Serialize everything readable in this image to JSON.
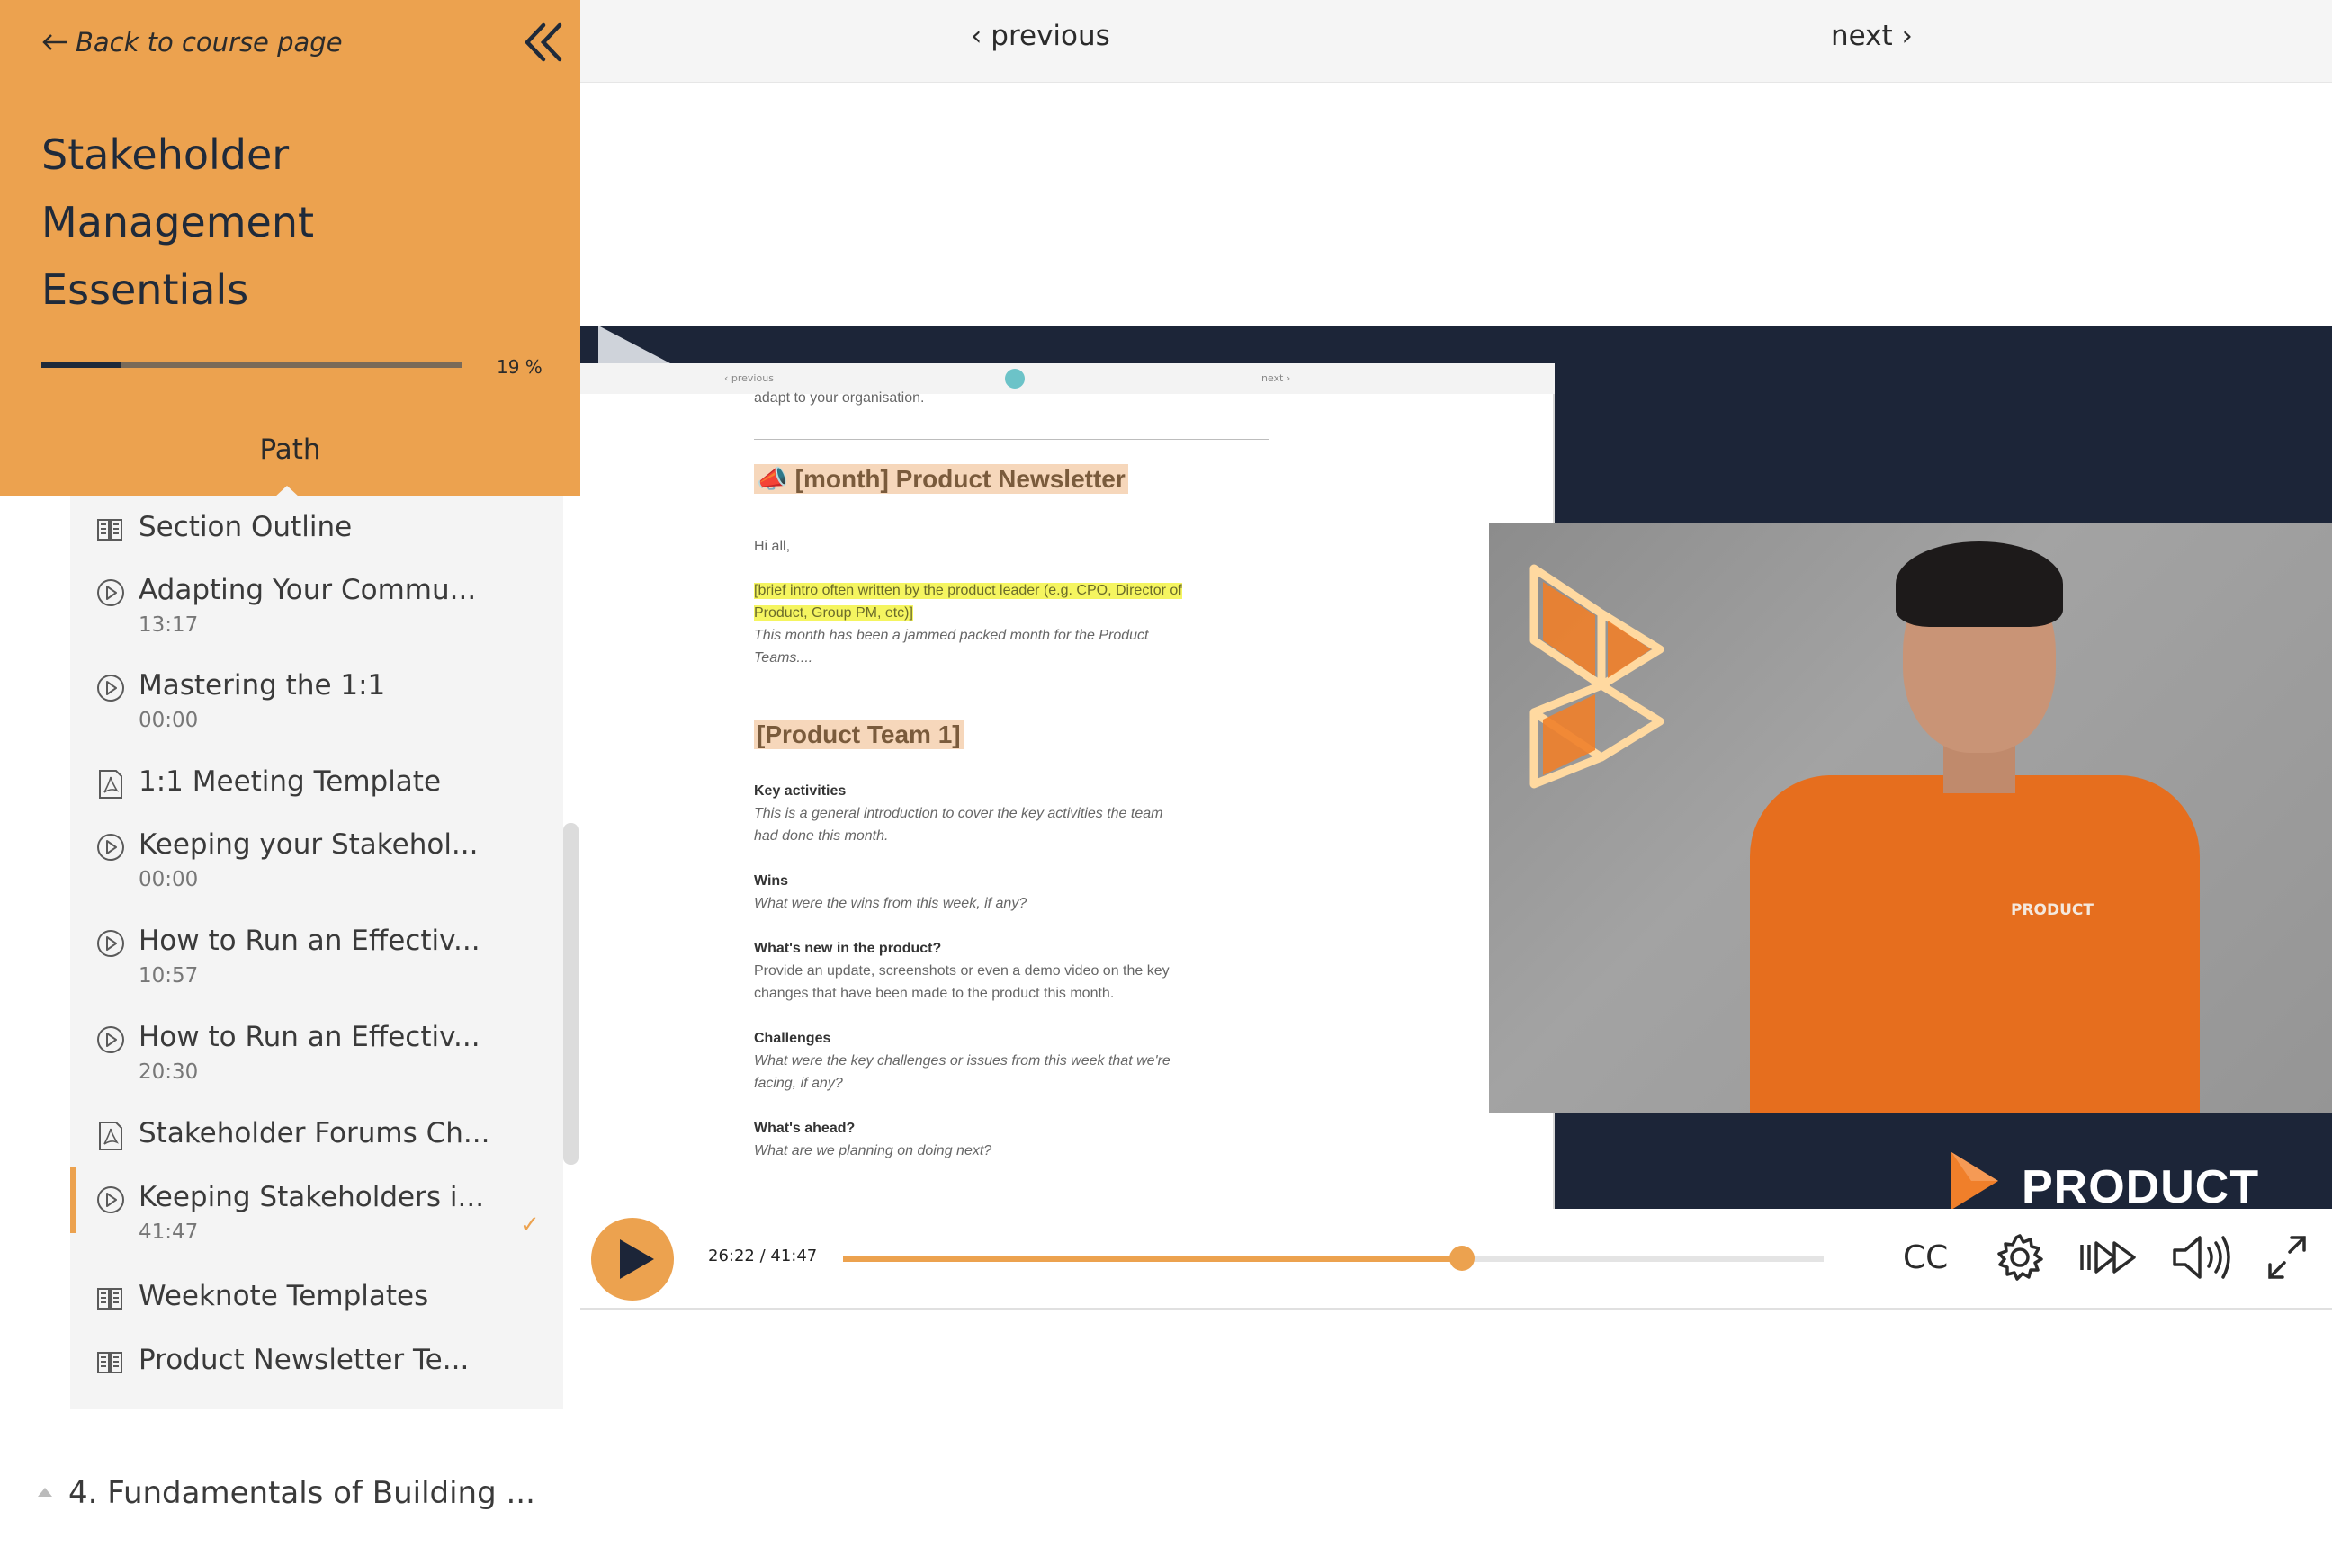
{
  "sidebar": {
    "back_label": "Back to course page",
    "course_title_lines": [
      "Stakeholder",
      "Management",
      "Essentials"
    ],
    "progress_percent": 19,
    "progress_label": "19 %",
    "tab_label": "Path",
    "lessons": [
      {
        "type": "document",
        "title": "Section Outline",
        "duration": ""
      },
      {
        "type": "video",
        "title": "Adapting Your Commu...",
        "duration": "13:17"
      },
      {
        "type": "video",
        "title": "Mastering the 1:1",
        "duration": "00:00"
      },
      {
        "type": "pdf",
        "title": "1:1 Meeting Template",
        "duration": ""
      },
      {
        "type": "video",
        "title": "Keeping your Stakehol...",
        "duration": "00:00"
      },
      {
        "type": "video",
        "title": "How to Run an Effectiv...",
        "duration": "10:57"
      },
      {
        "type": "video",
        "title": "How to Run an Effectiv...",
        "duration": "20:30"
      },
      {
        "type": "pdf",
        "title": "Stakeholder Forums Ch...",
        "duration": ""
      },
      {
        "type": "video",
        "title": "Keeping Stakeholders i...",
        "duration": "41:47",
        "active": true,
        "completed": true
      },
      {
        "type": "document",
        "title": "Weeknote Templates",
        "duration": ""
      },
      {
        "type": "document",
        "title": "Product Newsletter Te...",
        "duration": ""
      }
    ],
    "check_mark": "✓",
    "next_section_label": "4. Fundamentals of Building ..."
  },
  "nav": {
    "previous_label": "previous",
    "next_label": "next"
  },
  "video": {
    "current_time": "26:22",
    "duration": "41:47",
    "time_label": "26:22 / 41:47",
    "progress_fraction": 0.631,
    "cc_label": "CC",
    "brand_text": "PRODUCT",
    "shirt_text": "PRODUCT",
    "document": {
      "bar_previous": "‹ previous",
      "bar_next": "next ›",
      "top_line": "adapt to your organisation.",
      "heading1": "📣 [month] Product Newsletter",
      "greeting": "Hi all,",
      "highlight_line1": "[brief intro often written by the product leader (e.g. CPO, Director of",
      "highlight_line2": "Product, Group PM, etc)]",
      "intro_line1": "This month has been a jammed packed month for the Product",
      "intro_line2": "Teams....",
      "heading2": "[Product Team 1]",
      "key_activities_label": "Key activities",
      "key_activities_line1": "This is a general introduction to cover the key activities the team",
      "key_activities_line2": "had done this month.",
      "wins_label": "Wins",
      "wins_text": "What were the wins from this week, if any?",
      "whats_new_label": "What's new in the product?",
      "whats_new_line1": "Provide an update, screenshots or even a demo video on the key",
      "whats_new_line2": "changes that have been made to the product this month.",
      "challenges_label": "Challenges",
      "challenges_line1": "What were the key challenges or issues from this week that we're",
      "challenges_line2": "facing, if any?",
      "ahead_label": "What's ahead?",
      "ahead_text": "What  are we planning on doing next?"
    }
  },
  "colors": {
    "accent": "#eca24f",
    "dark_navy": "#1c2538",
    "panel": "#f4f4f4"
  }
}
